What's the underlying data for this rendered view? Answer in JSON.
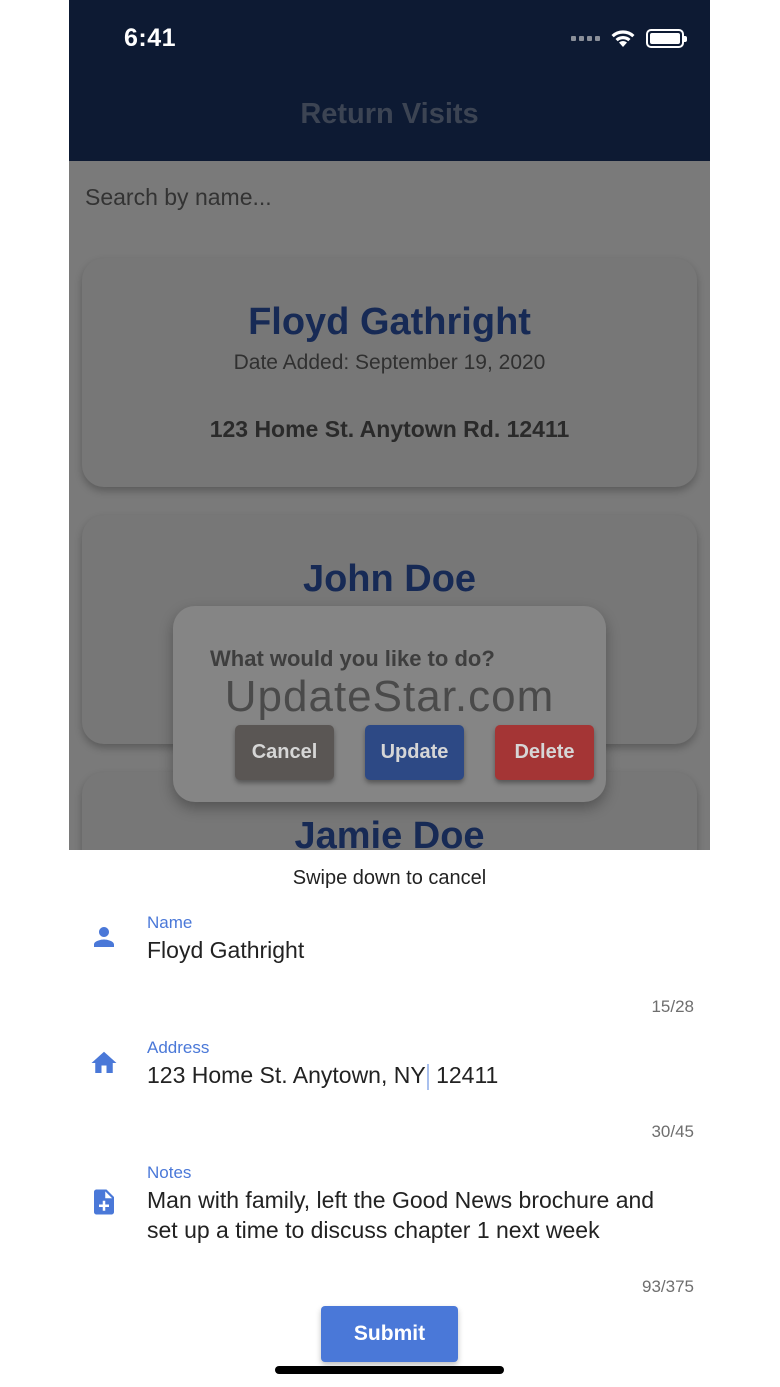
{
  "status_bar": {
    "time": "6:41"
  },
  "app": {
    "title": "Return Visits",
    "search_placeholder": "Search by name..."
  },
  "cards": [
    {
      "name": "Floyd Gathright",
      "date_added": "Date Added: September 19, 2020",
      "address": "123 Home St. Anytown Rd. 12411"
    },
    {
      "name": "John Doe"
    },
    {
      "name": "Jamie Doe"
    }
  ],
  "dialog": {
    "question": "What would you like to do?",
    "watermark": "UpdateStar.com",
    "cancel_label": "Cancel",
    "update_label": "Update",
    "delete_label": "Delete"
  },
  "sheet": {
    "hint": "Swipe down to cancel",
    "name": {
      "label": "Name",
      "value": "Floyd Gathright",
      "counter": "15/28",
      "icon": "person-icon"
    },
    "address": {
      "label": "Address",
      "value_before_caret": "123 Home St. Anytown, NY",
      "value_after_caret": " 12411",
      "counter": "30/45",
      "icon": "home-icon"
    },
    "notes": {
      "label": "Notes",
      "value": "Man with family, left the Good News brochure and set up a time to discuss chapter 1 next week",
      "counter": "93/375",
      "icon": "note-add-icon"
    },
    "submit_label": "Submit"
  },
  "colors": {
    "accent": "#4a78d8",
    "appbar": "#0d1a33"
  }
}
